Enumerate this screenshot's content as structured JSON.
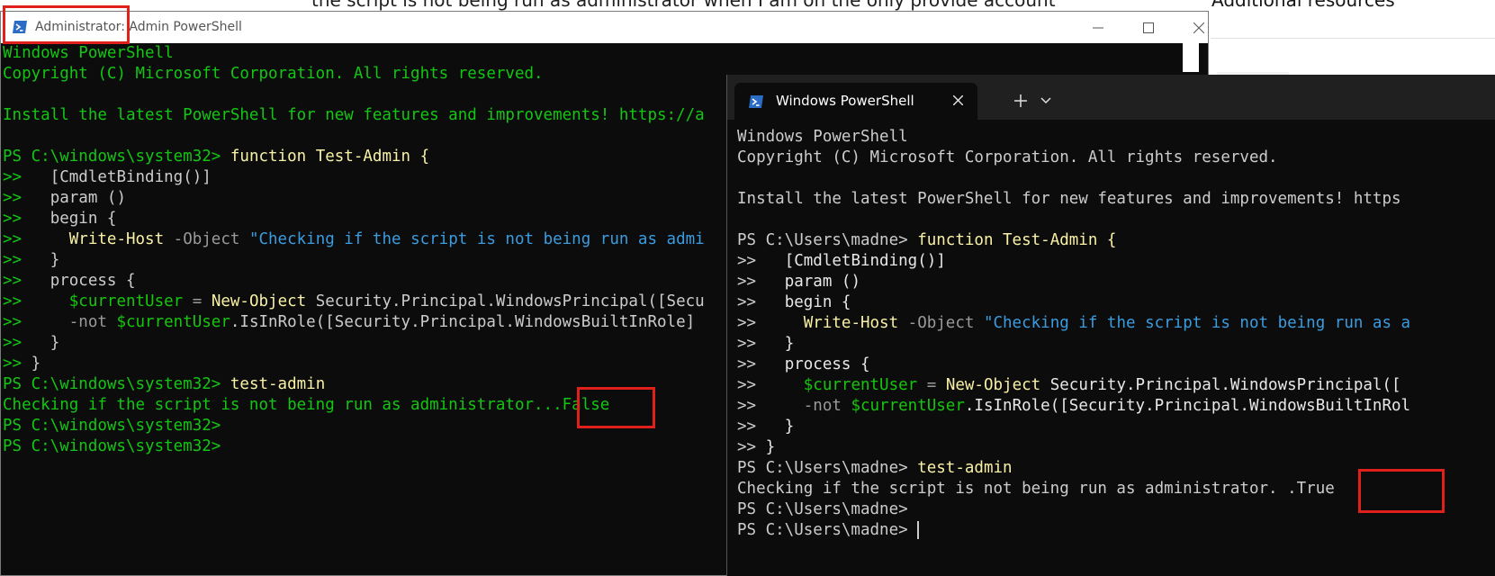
{
  "background_page": {
    "question_text": "the script is not being run as administrator when I am on the only provide account",
    "sidebar_heading": "Additional resources"
  },
  "admin_window": {
    "title": "Administrator: Admin PowerShell",
    "controls": {
      "minimize": "–",
      "maximize": "☐",
      "close": "✕"
    },
    "lines": [
      "Windows PowerShell",
      "Copyright (C) Microsoft Corporation. All rights reserved.",
      "",
      "Install the latest PowerShell for new features and improvements! https://a",
      "",
      "PS C:\\windows\\system32> |function Test-Admin {",
      ">>   |[CmdletBinding()]",
      ">>   |param ()",
      ">>   |begin {",
      ">>     |Write-Host| -Object |\"Checking if the script is not being run as admi",
      ">>   |}",
      ">>   |process {",
      ">>     |$currentUser| = |New-Object| Security.Principal.WindowsPrincipal([Secu",
      ">>     |-not |$currentUser|.IsInRole([Security.Principal.WindowsBuiltInRole]",
      ">>   |}",
      ">> |}",
      "PS C:\\windows\\system32> |test-admin",
      "Checking if the script is not being run as administrator...False",
      "PS C:\\windows\\system32>",
      "PS C:\\windows\\system32>"
    ]
  },
  "terminal_window": {
    "tab_title": "Windows PowerShell",
    "tab_close": "✕",
    "new_tab": "+",
    "dropdown": "⌄",
    "lines": [
      "Windows PowerShell",
      "Copyright (C) Microsoft Corporation. All rights reserved.",
      "",
      "Install the latest PowerShell for new features and improvements! https",
      "",
      "PS C:\\Users\\madne> |function Test-Admin {",
      ">>   |[CmdletBinding()]",
      ">>   |param ()",
      ">>   |begin {",
      ">>     |Write-Host| -Object |\"Checking if the script is not being run as a",
      ">>   |}",
      ">>   |process {",
      ">>     |$currentUser| = |New-Object| Security.Principal.WindowsPrincipal([",
      ">>     |-not |$currentUser|.IsInRole([Security.Principal.WindowsBuiltInRol",
      ">>   |}",
      ">> |}",
      "PS C:\\Users\\madne> |test-admin",
      "Checking if the script is not being run as administrator. .True",
      "PS C:\\Users\\madne>",
      "PS C:\\Users\\madne> "
    ]
  },
  "annotations": [
    {
      "name": "title-highlight",
      "target": "Administrator: Admin PowerShell"
    },
    {
      "name": "false-result-highlight",
      "target": "False"
    },
    {
      "name": "true-result-highlight",
      "target": "True"
    }
  ],
  "colors": {
    "annotation_red": "#e0201b",
    "terminal_bg": "#0c0c0c",
    "admin_text_green": "#13c613",
    "keyword_yellow": "#f9f1a5",
    "string_blue": "#3b9cdf"
  }
}
